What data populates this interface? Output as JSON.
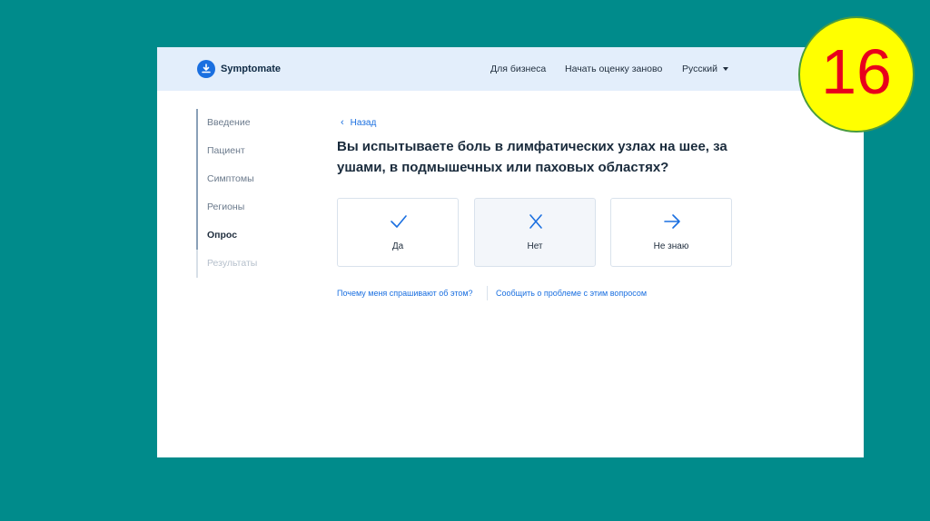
{
  "header": {
    "brand": "Symptomate",
    "nav": {
      "business": "Для бизнеса",
      "restart": "Начать оценку заново",
      "language": "Русский"
    }
  },
  "sidebar": {
    "items": [
      {
        "label": "Введение",
        "state": "done"
      },
      {
        "label": "Пациент",
        "state": "done"
      },
      {
        "label": "Симптомы",
        "state": "done"
      },
      {
        "label": "Регионы",
        "state": "done"
      },
      {
        "label": "Опрос",
        "state": "current"
      },
      {
        "label": "Результаты",
        "state": "future"
      }
    ]
  },
  "main": {
    "back_label": "Назад",
    "question": "Вы испытываете боль в лимфатических узлах на шее, за ушами, в подмышечных или паховых областях?",
    "answers": [
      {
        "label": "Да",
        "icon": "check-icon"
      },
      {
        "label": "Нет",
        "icon": "cross-icon"
      },
      {
        "label": "Не знаю",
        "icon": "arrow-right-icon"
      }
    ],
    "links": {
      "why": "Почему меня спрашивают об этом?",
      "report": "Сообщить о проблеме с этим вопросом"
    }
  },
  "badge": {
    "number": "16"
  },
  "colors": {
    "background": "#008b8b",
    "accent": "#1a6fe0",
    "header": "#e3eefb",
    "badge_fill": "#ffff00",
    "badge_text": "#e8001c"
  }
}
